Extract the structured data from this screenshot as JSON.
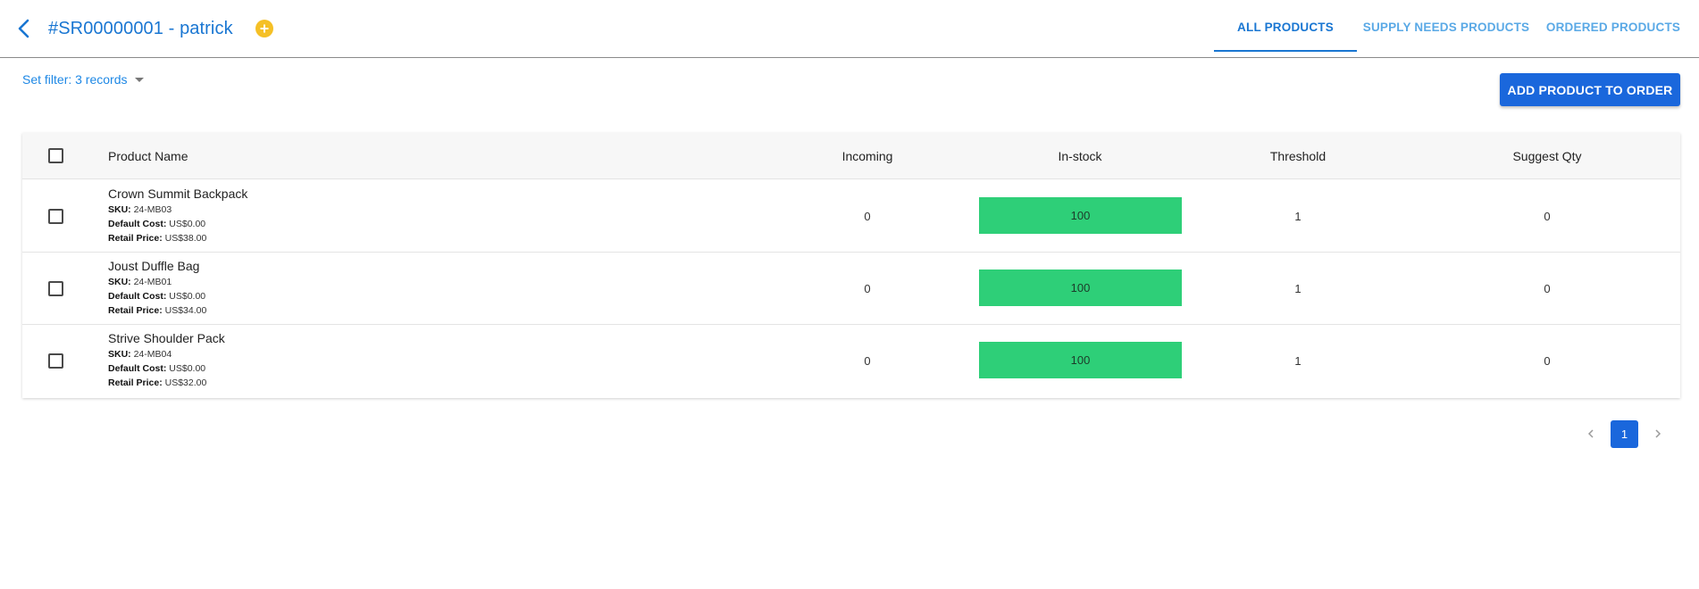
{
  "header": {
    "title": "#SR00000001 - patrick",
    "back_icon": "chevron-left-icon",
    "add_icon": "plus-circle-icon",
    "accent": "#1976d2",
    "add_icon_color": "#f5c026"
  },
  "tabs": [
    {
      "label": "ALL PRODUCTS",
      "active": true
    },
    {
      "label": "SUPPLY NEEDS PRODUCTS",
      "active": false
    },
    {
      "label": "ORDERED PRODUCTS",
      "active": false
    }
  ],
  "filter": {
    "label": "Set filter: 3 records",
    "icon": "caret-down-icon"
  },
  "actions": {
    "add_product_label": "ADD PRODUCT TO ORDER",
    "button_color": "#1a67dc"
  },
  "table": {
    "columns": {
      "product_name": "Product Name",
      "incoming": "Incoming",
      "in_stock": "In-stock",
      "threshold": "Threshold",
      "suggest_qty": "Suggest Qty"
    },
    "meta_labels": {
      "sku": "SKU:",
      "default_cost": "Default Cost:",
      "retail_price": "Retail Price:"
    },
    "rows": [
      {
        "name": "Crown Summit Backpack",
        "sku": "24-MB03",
        "default_cost": "US$0.00",
        "retail_price": "US$38.00",
        "incoming": "0",
        "in_stock": "100",
        "threshold": "1",
        "suggest_qty": "0"
      },
      {
        "name": "Joust Duffle Bag",
        "sku": "24-MB01",
        "default_cost": "US$0.00",
        "retail_price": "US$34.00",
        "incoming": "0",
        "in_stock": "100",
        "threshold": "1",
        "suggest_qty": "0"
      },
      {
        "name": "Strive Shoulder Pack",
        "sku": "24-MB04",
        "default_cost": "US$0.00",
        "retail_price": "US$32.00",
        "incoming": "0",
        "in_stock": "100",
        "threshold": "1",
        "suggest_qty": "0"
      }
    ],
    "stock_color": "#2ecf78"
  },
  "pagination": {
    "current_page": "1",
    "prev_icon": "chevron-left-icon",
    "next_icon": "chevron-right-icon"
  }
}
